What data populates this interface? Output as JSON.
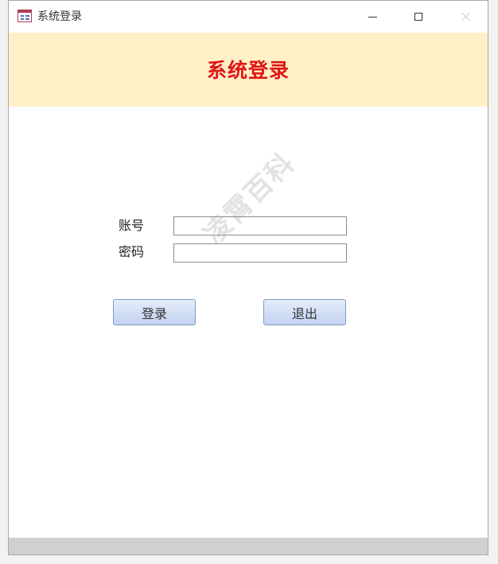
{
  "window": {
    "title": "系统登录",
    "icon": "access-form-icon"
  },
  "header": {
    "title": "系统登录",
    "background": "#fff0c8",
    "title_color": "#e01515"
  },
  "form": {
    "account_label": "账号",
    "account_value": "",
    "password_label": "密码",
    "password_value": ""
  },
  "buttons": {
    "login_label": "登录",
    "exit_label": "退出"
  },
  "watermark": "凌霄百科"
}
